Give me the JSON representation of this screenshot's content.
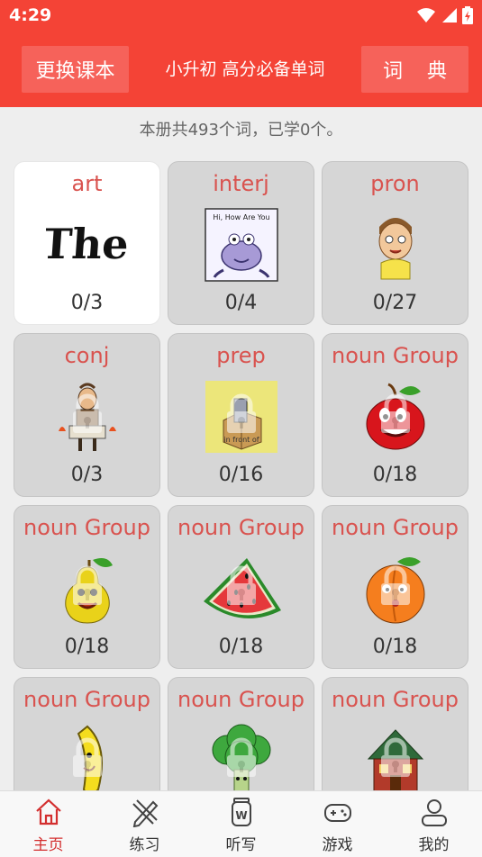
{
  "status": {
    "time": "4:29"
  },
  "header": {
    "change_book": "更换课本",
    "title": "小升初 高分必备单词",
    "dictionary": "词 典"
  },
  "summary": "本册共493个词，已学0个。",
  "categories": [
    {
      "label": "art",
      "progress": "0/3",
      "icon": "the-word-image",
      "locked": false,
      "active": true
    },
    {
      "label": "interj",
      "progress": "0/4",
      "icon": "hi-how-are-you-alien-image",
      "locked": false,
      "active": false
    },
    {
      "label": "pron",
      "progress": "0/27",
      "icon": "boy-face-image",
      "locked": false,
      "active": false
    },
    {
      "label": "conj",
      "progress": "0/3",
      "icon": "man-with-torches-image",
      "locked": true,
      "active": false
    },
    {
      "label": "prep",
      "progress": "0/16",
      "icon": "in-front-of-box-image",
      "locked": true,
      "active": false,
      "caption": "in front of"
    },
    {
      "label": "noun Group",
      "progress": "0/18",
      "icon": "apple-image",
      "locked": true,
      "active": false
    },
    {
      "label": "noun Group",
      "progress": "0/18",
      "icon": "pear-image",
      "locked": true,
      "active": false
    },
    {
      "label": "noun Group",
      "progress": "0/18",
      "icon": "watermelon-image",
      "locked": true,
      "active": false
    },
    {
      "label": "noun Group",
      "progress": "0/18",
      "icon": "peach-image",
      "locked": true,
      "active": false
    },
    {
      "label": "noun Group",
      "progress": "",
      "icon": "banana-image",
      "locked": true,
      "active": false
    },
    {
      "label": "noun Group",
      "progress": "",
      "icon": "broccoli-image",
      "locked": true,
      "active": false
    },
    {
      "label": "noun Group",
      "progress": "",
      "icon": "house-image",
      "locked": true,
      "active": false
    }
  ],
  "nav": [
    {
      "label": "主页",
      "icon": "home-icon",
      "active": true
    },
    {
      "label": "练习",
      "icon": "pencil-ruler-icon",
      "active": false
    },
    {
      "label": "听写",
      "icon": "dictation-cup-icon",
      "active": false
    },
    {
      "label": "游戏",
      "icon": "gamepad-icon",
      "active": false
    },
    {
      "label": "我的",
      "icon": "person-icon",
      "active": false
    }
  ],
  "colors": {
    "primary": "#f44336",
    "label_red": "#d9534f",
    "active_nav": "#d32f2f"
  }
}
